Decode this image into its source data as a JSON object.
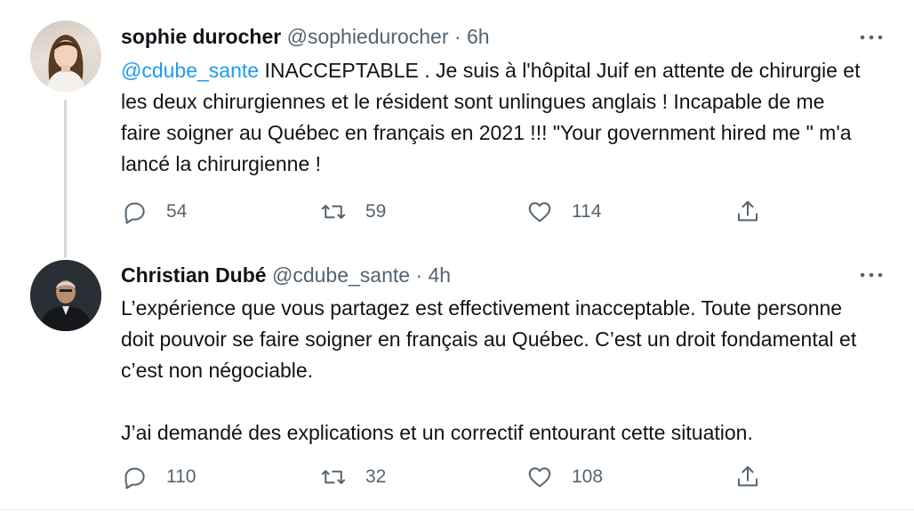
{
  "tweets": [
    {
      "author_name": "sophie durocher",
      "handle": "@sophiedurocher",
      "separator": "·",
      "time": "6h",
      "mention": "@cdube_sante",
      "text": " INACCEPTABLE . Je suis à l'hôpital Juif en attente de chirurgie et les deux chirurgiennes et le résident sont unlingues anglais ! Incapable de me faire soigner au Québec en français en 2021 !!! \"Your government hired me \" m'a lancé la chirurgienne !",
      "replies": "54",
      "retweets": "59",
      "likes": "114"
    },
    {
      "author_name": "Christian Dubé",
      "handle": "@cdube_sante",
      "separator": "·",
      "time": "4h",
      "text": "L’expérience que vous partagez est effectivement inacceptable. Toute personne doit pouvoir se faire soigner en français au Québec. C’est un droit fondamental et c’est non négociable.\n\nJ’ai demandé des explications et un correctif entourant cette situation.",
      "replies": "110",
      "retweets": "32",
      "likes": "108"
    }
  ],
  "icons": {
    "reply": "reply-icon",
    "retweet": "retweet-icon",
    "like": "heart-icon",
    "share": "share-icon",
    "more": "more-icon"
  },
  "colors": {
    "text": "#0f1419",
    "secondary": "#536471",
    "link": "#1d9bf0",
    "border": "#e6ecf0",
    "thread_line": "#cfd9de"
  }
}
